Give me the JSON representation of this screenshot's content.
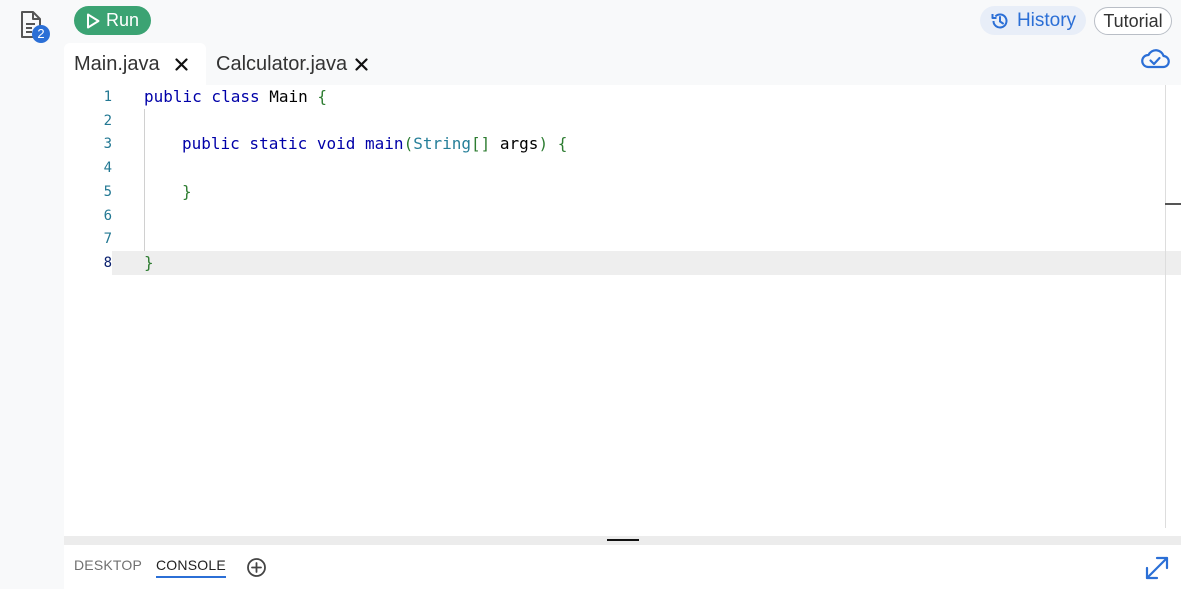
{
  "sidebar": {
    "files_badge": "2",
    "icons": {
      "files": "file-list-icon"
    }
  },
  "toolbar": {
    "run_label": "Run",
    "history_label": "History",
    "tutorial_label": "Tutorial",
    "icons": {
      "run": "play-icon",
      "history": "history-icon",
      "save_status": "cloud-check-icon"
    }
  },
  "tabs": [
    {
      "label": "Main.java",
      "active": true
    },
    {
      "label": "Calculator.java",
      "active": false
    }
  ],
  "editor": {
    "current_line": 8,
    "lines": [
      {
        "num": "1"
      },
      {
        "num": "2"
      },
      {
        "num": "3"
      },
      {
        "num": "4"
      },
      {
        "num": "5"
      },
      {
        "num": "6"
      },
      {
        "num": "7"
      },
      {
        "num": "8"
      }
    ],
    "code": {
      "l1_kw": "public class",
      "l1_name": " Main ",
      "l1_brace": "{",
      "l3_kw": "public static void",
      "l3_name": " main",
      "l3_paren_open": "(",
      "l3_type": "String",
      "l3_brackets": "[]",
      "l3_arg": " args",
      "l3_paren_close": ") ",
      "l3_brace": "{",
      "l5_brace": "}",
      "l8_brace": "}"
    }
  },
  "bottom_panel": {
    "tabs": [
      {
        "label": "DESKTOP",
        "active": false
      },
      {
        "label": "CONSOLE",
        "active": true
      }
    ],
    "icons": {
      "add": "add-circle-icon",
      "expand": "expand-icon"
    }
  },
  "colors": {
    "run_green": "#3ba373",
    "accent_blue": "#2b6fd6",
    "keyword": "#0000a8",
    "bracket": "#2e7d32",
    "type": "#267f99",
    "line_number": "#237893"
  }
}
